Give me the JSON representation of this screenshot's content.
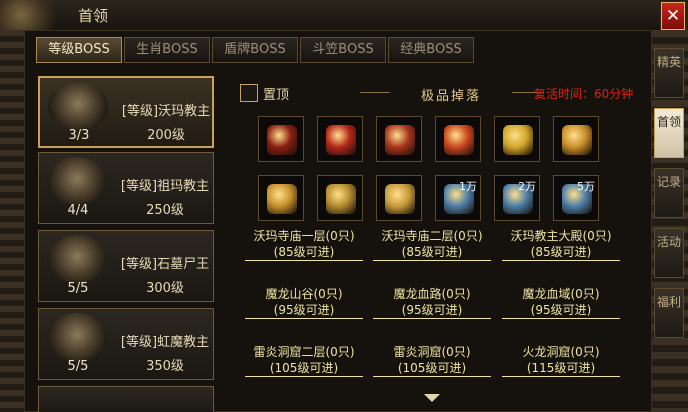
{
  "window": {
    "title": "首领"
  },
  "tabs": [
    {
      "label": "等级BOSS",
      "active": true
    },
    {
      "label": "生肖BOSS",
      "active": false
    },
    {
      "label": "盾牌BOSS",
      "active": false
    },
    {
      "label": "斗笠BOSS",
      "active": false
    },
    {
      "label": "经典BOSS",
      "active": false
    }
  ],
  "bosses": [
    {
      "name": "[等级]沃玛教主",
      "level": "200级",
      "count": "3/3",
      "selected": true
    },
    {
      "name": "[等级]祖玛教主",
      "level": "250级",
      "count": "4/4",
      "selected": false
    },
    {
      "name": "[等级]石墓尸王",
      "level": "300级",
      "count": "5/5",
      "selected": false
    },
    {
      "name": "[等级]虹魔教主",
      "level": "350级",
      "count": "5/5",
      "selected": false
    }
  ],
  "pin": {
    "label": "置顶"
  },
  "drops": {
    "title": "极品掉落",
    "items": [
      {
        "icon": "weapon-icon",
        "color": "#8c1d12"
      },
      {
        "icon": "helmet-icon",
        "color": "#b3261a"
      },
      {
        "icon": "dragon-icon",
        "color": "#a8341c"
      },
      {
        "icon": "armor-icon",
        "color": "#c9461e"
      },
      {
        "icon": "necklace-icon",
        "color": "#d1a52a"
      },
      {
        "icon": "bracelet-icon",
        "color": "#c98d2a"
      },
      {
        "icon": "ring-icon",
        "color": "#c7902c"
      },
      {
        "icon": "crown-icon",
        "color": "#b58a2f"
      },
      {
        "icon": "boots-icon",
        "color": "#c99b3b"
      },
      {
        "icon": "scroll-icon",
        "color": "#4d7ea8",
        "qty": "1万"
      },
      {
        "icon": "scroll-icon",
        "color": "#4d7ea8",
        "qty": "2万"
      },
      {
        "icon": "scroll-icon",
        "color": "#4d7ea8",
        "qty": "5万"
      }
    ]
  },
  "respawn": {
    "text": "复活时间：60分钟"
  },
  "maps": [
    {
      "name": "沃玛寺庙一层(0只)",
      "req": "(85级可进)"
    },
    {
      "name": "沃玛寺庙二层(0只)",
      "req": "(85级可进)"
    },
    {
      "name": "沃玛教主大殿(0只)",
      "req": "(85级可进)"
    },
    {
      "name": "魔龙山谷(0只)",
      "req": "(95级可进)"
    },
    {
      "name": "魔龙血路(0只)",
      "req": "(95级可进)"
    },
    {
      "name": "魔龙血域(0只)",
      "req": "(95级可进)"
    },
    {
      "name": "雷炎洞窟二层(0只)",
      "req": "(105级可进)"
    },
    {
      "name": "雷炎洞窟(0只)",
      "req": "(105级可进)"
    },
    {
      "name": "火龙洞窟(0只)",
      "req": "(115级可进)"
    }
  ],
  "side_tabs": [
    {
      "label": "精英",
      "active": false
    },
    {
      "label": "首领",
      "active": true
    },
    {
      "label": "记录",
      "active": false
    },
    {
      "label": "活动",
      "active": false
    },
    {
      "label": "福利",
      "active": false
    }
  ]
}
